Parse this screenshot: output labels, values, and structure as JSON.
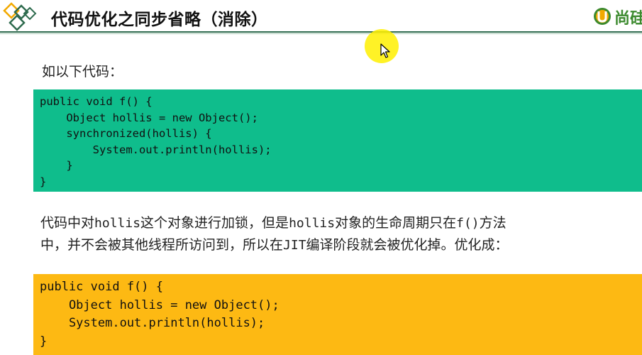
{
  "header": {
    "title": "代码优化之同步省略（消除）",
    "brand_text": "尚硅",
    "logo_left_icon": "diamond-logo-icon",
    "brand_icon": "u-brand-icon",
    "accent_color": "#2e6b4e",
    "brand_color": "#3c8a2e"
  },
  "slide": {
    "intro": "如以下代码：",
    "code_before": [
      "public void f() {",
      "    Object hollis = new Object();",
      "    synchronized(hollis) {",
      "        System.out.println(hollis);",
      "    }",
      "}"
    ],
    "explanation": {
      "line1": [
        {
          "t": "代码中对",
          "mono": false
        },
        {
          "t": "hollis",
          "mono": true
        },
        {
          "t": "这个对象进行加锁，但是",
          "mono": false
        },
        {
          "t": "hollis",
          "mono": true
        },
        {
          "t": "对象的生命周期只在",
          "mono": false
        },
        {
          "t": "f()",
          "mono": true
        },
        {
          "t": "方法",
          "mono": false
        }
      ],
      "line2": [
        {
          "t": "中，并不会被其他线程所访问到，所以在",
          "mono": false
        },
        {
          "t": "JIT",
          "mono": true
        },
        {
          "t": "编译阶段就会被优化掉。优化成：",
          "mono": false
        }
      ]
    },
    "code_after": [
      "public void f() {",
      "    Object hollis = new Object();",
      "    System.out.println(hollis);",
      "}"
    ],
    "code_before_bg": "#0fbd8c",
    "code_after_bg": "#fdb913"
  },
  "overlay": {
    "cursor_icon": "mouse-pointer-icon",
    "highlight_color": "#fff000"
  }
}
